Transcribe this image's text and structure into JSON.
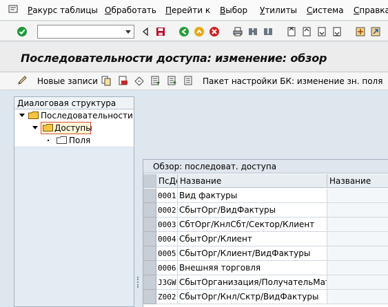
{
  "menu": {
    "items": [
      {
        "underline": "Р",
        "rest": "акурс таблицы"
      },
      {
        "underline": "О",
        "rest": "бработать"
      },
      {
        "underline": "П",
        "rest": "ерейти к"
      },
      {
        "underline": "В",
        "rest": "ыбор"
      },
      {
        "underline": "У",
        "rest": "тилиты"
      },
      {
        "underline": "С",
        "rest": "истема"
      },
      {
        "underline": "С",
        "rest": "правка"
      }
    ]
  },
  "command_field": {
    "value": ""
  },
  "title": "Последовательности доступа: изменение: обзор",
  "app_toolbar": {
    "new_entries": "Новые записи",
    "bc_set": "Пакет настройки БК: изменение зн. поля"
  },
  "dialog_structure": {
    "header": "Диалоговая структура",
    "nodes": [
      {
        "label": "Последовательности доступа"
      },
      {
        "label": "Доступы"
      },
      {
        "label": "Поля"
      }
    ]
  },
  "table": {
    "title": "Обзор: последоват. доступа",
    "columns": [
      "ПсДс",
      "Название",
      "Название"
    ],
    "rows": [
      {
        "code": "0001",
        "name": "Вид фактуры"
      },
      {
        "code": "0002",
        "name": "СбытОрг/ВидФактуры"
      },
      {
        "code": "0003",
        "name": "СбтОрг/КнлСбт/Сектор/Клиент"
      },
      {
        "code": "0004",
        "name": "СбытОрг/Клиент"
      },
      {
        "code": "0005",
        "name": "СбытОрг/Клиент/ВидФактуры"
      },
      {
        "code": "0006",
        "name": "Внешняя торговля"
      },
      {
        "code": "J3GW",
        "name": "СбытОрганизация/ПолучательМат"
      },
      {
        "code": "Z002",
        "name": "СбытОрг/Кнл/Сктр/ВидФактуры"
      }
    ]
  },
  "colors": {
    "green_check": "#1e9a3a",
    "save_red": "#b6002a",
    "folder_yellow": "#f5c542",
    "selected_node_border": "#d4512b"
  }
}
